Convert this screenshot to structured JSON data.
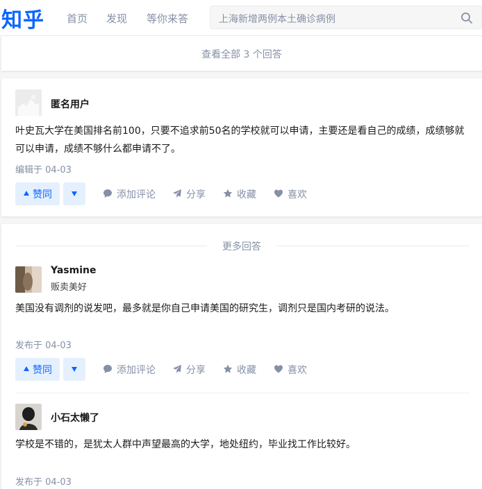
{
  "header": {
    "logo": "知乎",
    "nav": [
      "首页",
      "发现",
      "等你来答"
    ],
    "search_placeholder": "上海新增两例本土确诊病例"
  },
  "view_all": "查看全部 3 个回答",
  "answers": [
    {
      "author": "匿名用户",
      "content": "叶史瓦大学在美国排名前100，只要不追求前50名的学校就可以申请，主要还是看自己的成绩，成绩够就可以申请，成绩不够什么都申请不了。",
      "date": "编辑于 04-03"
    },
    {
      "author": "Yasmine",
      "bio": "贩卖美好",
      "content": "美国没有调剂的说发吧，最多就是你自己申请美国的研究生，调剂只是国内考研的说法。",
      "date": "发布于 04-03"
    },
    {
      "author": "小石太懒了",
      "content": "学校是不错的，是犹太人群中声望最高的大学，地处纽约，毕业找工作比较好。",
      "date": "发布于 04-03"
    }
  ],
  "actions": {
    "upvote": "赞同",
    "comment": "添加评论",
    "share": "分享",
    "favorite": "收藏",
    "like": "喜欢"
  },
  "more_answers": "更多回答",
  "colors": {
    "brand": "#0a66ff",
    "muted": "#8590a6"
  }
}
